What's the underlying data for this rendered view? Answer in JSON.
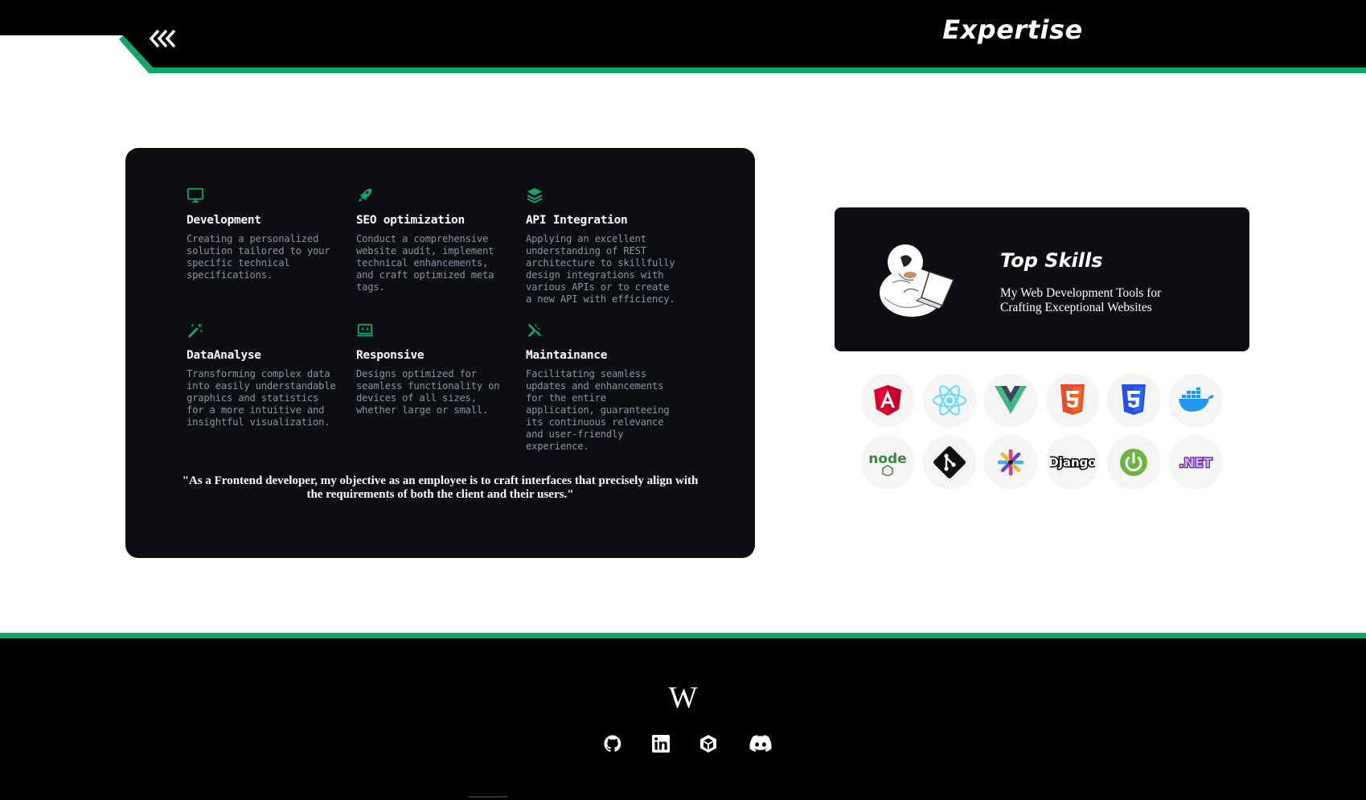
{
  "header": {
    "title": "Expertise",
    "back_icon": "double-chevron-left-icon"
  },
  "colors": {
    "accent": "#12a76a",
    "card_bg": "#0d0e12",
    "muted_text": "#8a93a6",
    "header_bg": "#000000"
  },
  "services": [
    {
      "icon": "monitor-icon",
      "title": "Development",
      "description": "Creating a personalized solution tailored to your specific technical specifications."
    },
    {
      "icon": "rocket-icon",
      "title": "SEO optimization",
      "description": "Conduct a comprehensive website audit, implement technical enhancements, and craft optimized meta tags."
    },
    {
      "icon": "layers-icon",
      "title": "API Integration",
      "description": "Applying an excellent understanding of REST architecture to skillfully design integrations with various APIs or to create a new API with efficiency."
    },
    {
      "icon": "magic-wand-icon",
      "title": "DataAnalyse",
      "description": "Transforming complex data into easily understandable graphics and statistics for a more intuitive and insightful visualization."
    },
    {
      "icon": "laptop-code-icon",
      "title": "Responsive",
      "description": "Designs optimized for seamless functionality on devices of all sizes, whether large or small."
    },
    {
      "icon": "tools-icon",
      "title": "Maintainance",
      "description": "Facilitating seamless updates and enhancements for the entire application, guaranteeing its continuous relevance and user-friendly experience."
    }
  ],
  "quote": "\"As a Frontend developer, my objective as an employee is to craft interfaces that precisely align with the requirements of both the client and their users.\"",
  "skills": {
    "title": "Top Skills",
    "subtitle": "My Web Development Tools for Crafting Exceptional Websites",
    "illustration": "developer-with-laptop-illustration"
  },
  "tech_icons": [
    "angular-icon",
    "react-icon",
    "vue-icon",
    "html5-icon",
    "css3-icon",
    "docker-icon",
    "nodejs-icon",
    "git-icon",
    "jest-icon",
    "django-icon",
    "spring-boot-icon",
    "dotnet-icon"
  ],
  "tech_labels": {
    "node": "node",
    "django": "Django",
    "dotnet": ".NET"
  },
  "footer": {
    "logo": "W",
    "social": [
      "github-icon",
      "linkedin-icon",
      "unity-icon",
      "discord-icon"
    ]
  }
}
